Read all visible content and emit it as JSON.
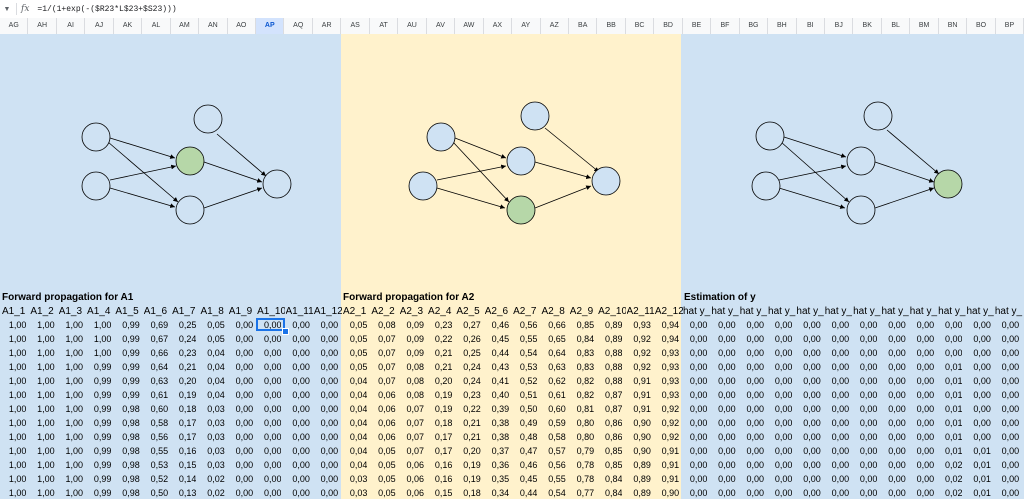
{
  "formula_bar": {
    "dropdown_icon": "chevron-down-icon",
    "fx_label": "fx",
    "formula": "=1/(1+exp(-($R23*L$23+$S23)))"
  },
  "columns": [
    "AG",
    "AH",
    "AI",
    "AJ",
    "AK",
    "AL",
    "AM",
    "AN",
    "AO",
    "AP",
    "AQ",
    "AR",
    "AS",
    "AT",
    "AU",
    "AV",
    "AW",
    "AX",
    "AY",
    "AZ",
    "BA",
    "BB",
    "BC",
    "BD",
    "BE",
    "BF",
    "BG",
    "BH",
    "BI",
    "BJ",
    "BK",
    "BL",
    "BM",
    "BN",
    "BO",
    "BP"
  ],
  "selected_column": "AP",
  "colors": {
    "panel_blue": "#cfe2f3",
    "panel_yellow": "#fff2cc",
    "node_blue": "#cfe2f3",
    "node_green": "#b6d7a8",
    "selection": "#1a73e8"
  },
  "sections": [
    {
      "title": "Forward propagation for A1",
      "headers": [
        "A1_1",
        "A1_2",
        "A1_3",
        "A1_4",
        "A1_5",
        "A1_6",
        "A1_7",
        "A1_8",
        "A1_9",
        "A1_10",
        "A1_11",
        "A1_12"
      ]
    },
    {
      "title": "Forward propagation for A2",
      "headers": [
        "A2_1",
        "A2_2",
        "A2_3",
        "A2_4",
        "A2_5",
        "A2_6",
        "A2_7",
        "A2_8",
        "A2_9",
        "A2_10",
        "A2_11",
        "A2_12"
      ]
    },
    {
      "title": "Estimation of y",
      "headers": [
        "hat y_",
        "hat y_",
        "hat y_",
        "hat y_",
        "hat y_",
        "hat y_",
        "hat y_",
        "hat y_",
        "hat y_",
        "hat y_",
        "hat y_",
        "hat y_"
      ]
    }
  ],
  "rows": [
    [
      [
        "1,00",
        "1,00",
        "1,00",
        "1,00",
        "0,99",
        "0,69",
        "0,25",
        "0,05",
        "0,00",
        "0,00",
        "0,00",
        "0,00"
      ],
      [
        "0,05",
        "0,08",
        "0,09",
        "0,23",
        "0,27",
        "0,46",
        "0,56",
        "0,66",
        "0,85",
        "0,89",
        "0,93",
        "0,94"
      ],
      [
        "0,00",
        "0,00",
        "0,00",
        "0,00",
        "0,00",
        "0,00",
        "0,00",
        "0,00",
        "0,00",
        "0,00",
        "0,00",
        "0,00"
      ]
    ],
    [
      [
        "1,00",
        "1,00",
        "1,00",
        "1,00",
        "0,99",
        "0,67",
        "0,24",
        "0,05",
        "0,00",
        "0,00",
        "0,00",
        "0,00"
      ],
      [
        "0,05",
        "0,07",
        "0,09",
        "0,22",
        "0,26",
        "0,45",
        "0,55",
        "0,65",
        "0,84",
        "0,89",
        "0,92",
        "0,94"
      ],
      [
        "0,00",
        "0,00",
        "0,00",
        "0,00",
        "0,00",
        "0,00",
        "0,00",
        "0,00",
        "0,00",
        "0,00",
        "0,00",
        "0,00"
      ]
    ],
    [
      [
        "1,00",
        "1,00",
        "1,00",
        "1,00",
        "0,99",
        "0,66",
        "0,23",
        "0,04",
        "0,00",
        "0,00",
        "0,00",
        "0,00"
      ],
      [
        "0,05",
        "0,07",
        "0,09",
        "0,21",
        "0,25",
        "0,44",
        "0,54",
        "0,64",
        "0,83",
        "0,88",
        "0,92",
        "0,93"
      ],
      [
        "0,00",
        "0,00",
        "0,00",
        "0,00",
        "0,00",
        "0,00",
        "0,00",
        "0,00",
        "0,00",
        "0,00",
        "0,00",
        "0,00"
      ]
    ],
    [
      [
        "1,00",
        "1,00",
        "1,00",
        "0,99",
        "0,99",
        "0,64",
        "0,21",
        "0,04",
        "0,00",
        "0,00",
        "0,00",
        "0,00"
      ],
      [
        "0,05",
        "0,07",
        "0,08",
        "0,21",
        "0,24",
        "0,43",
        "0,53",
        "0,63",
        "0,83",
        "0,88",
        "0,92",
        "0,93"
      ],
      [
        "0,00",
        "0,00",
        "0,00",
        "0,00",
        "0,00",
        "0,00",
        "0,00",
        "0,00",
        "0,00",
        "0,01",
        "0,00",
        "0,00"
      ]
    ],
    [
      [
        "1,00",
        "1,00",
        "1,00",
        "0,99",
        "0,99",
        "0,63",
        "0,20",
        "0,04",
        "0,00",
        "0,00",
        "0,00",
        "0,00"
      ],
      [
        "0,04",
        "0,07",
        "0,08",
        "0,20",
        "0,24",
        "0,41",
        "0,52",
        "0,62",
        "0,82",
        "0,88",
        "0,91",
        "0,93"
      ],
      [
        "0,00",
        "0,00",
        "0,00",
        "0,00",
        "0,00",
        "0,00",
        "0,00",
        "0,00",
        "0,00",
        "0,01",
        "0,00",
        "0,00"
      ]
    ],
    [
      [
        "1,00",
        "1,00",
        "1,00",
        "0,99",
        "0,99",
        "0,61",
        "0,19",
        "0,04",
        "0,00",
        "0,00",
        "0,00",
        "0,00"
      ],
      [
        "0,04",
        "0,06",
        "0,08",
        "0,19",
        "0,23",
        "0,40",
        "0,51",
        "0,61",
        "0,82",
        "0,87",
        "0,91",
        "0,93"
      ],
      [
        "0,00",
        "0,00",
        "0,00",
        "0,00",
        "0,00",
        "0,00",
        "0,00",
        "0,00",
        "0,00",
        "0,01",
        "0,00",
        "0,00"
      ]
    ],
    [
      [
        "1,00",
        "1,00",
        "1,00",
        "0,99",
        "0,98",
        "0,60",
        "0,18",
        "0,03",
        "0,00",
        "0,00",
        "0,00",
        "0,00"
      ],
      [
        "0,04",
        "0,06",
        "0,07",
        "0,19",
        "0,22",
        "0,39",
        "0,50",
        "0,60",
        "0,81",
        "0,87",
        "0,91",
        "0,92"
      ],
      [
        "0,00",
        "0,00",
        "0,00",
        "0,00",
        "0,00",
        "0,00",
        "0,00",
        "0,00",
        "0,00",
        "0,01",
        "0,00",
        "0,00"
      ]
    ],
    [
      [
        "1,00",
        "1,00",
        "1,00",
        "0,99",
        "0,98",
        "0,58",
        "0,17",
        "0,03",
        "0,00",
        "0,00",
        "0,00",
        "0,00"
      ],
      [
        "0,04",
        "0,06",
        "0,07",
        "0,18",
        "0,21",
        "0,38",
        "0,49",
        "0,59",
        "0,80",
        "0,86",
        "0,90",
        "0,92"
      ],
      [
        "0,00",
        "0,00",
        "0,00",
        "0,00",
        "0,00",
        "0,00",
        "0,00",
        "0,00",
        "0,00",
        "0,01",
        "0,00",
        "0,00"
      ]
    ],
    [
      [
        "1,00",
        "1,00",
        "1,00",
        "0,99",
        "0,98",
        "0,56",
        "0,17",
        "0,03",
        "0,00",
        "0,00",
        "0,00",
        "0,00"
      ],
      [
        "0,04",
        "0,06",
        "0,07",
        "0,17",
        "0,21",
        "0,38",
        "0,48",
        "0,58",
        "0,80",
        "0,86",
        "0,90",
        "0,92"
      ],
      [
        "0,00",
        "0,00",
        "0,00",
        "0,00",
        "0,00",
        "0,00",
        "0,00",
        "0,00",
        "0,00",
        "0,01",
        "0,00",
        "0,00"
      ]
    ],
    [
      [
        "1,00",
        "1,00",
        "1,00",
        "0,99",
        "0,98",
        "0,55",
        "0,16",
        "0,03",
        "0,00",
        "0,00",
        "0,00",
        "0,00"
      ],
      [
        "0,04",
        "0,05",
        "0,07",
        "0,17",
        "0,20",
        "0,37",
        "0,47",
        "0,57",
        "0,79",
        "0,85",
        "0,90",
        "0,91"
      ],
      [
        "0,00",
        "0,00",
        "0,00",
        "0,00",
        "0,00",
        "0,00",
        "0,00",
        "0,00",
        "0,00",
        "0,01",
        "0,01",
        "0,00"
      ]
    ],
    [
      [
        "1,00",
        "1,00",
        "1,00",
        "0,99",
        "0,98",
        "0,53",
        "0,15",
        "0,03",
        "0,00",
        "0,00",
        "0,00",
        "0,00"
      ],
      [
        "0,04",
        "0,05",
        "0,06",
        "0,16",
        "0,19",
        "0,36",
        "0,46",
        "0,56",
        "0,78",
        "0,85",
        "0,89",
        "0,91"
      ],
      [
        "0,00",
        "0,00",
        "0,00",
        "0,00",
        "0,00",
        "0,00",
        "0,00",
        "0,00",
        "0,00",
        "0,02",
        "0,01",
        "0,00"
      ]
    ],
    [
      [
        "1,00",
        "1,00",
        "1,00",
        "0,99",
        "0,98",
        "0,52",
        "0,14",
        "0,02",
        "0,00",
        "0,00",
        "0,00",
        "0,00"
      ],
      [
        "0,03",
        "0,05",
        "0,06",
        "0,16",
        "0,19",
        "0,35",
        "0,45",
        "0,55",
        "0,78",
        "0,84",
        "0,89",
        "0,91"
      ],
      [
        "0,00",
        "0,00",
        "0,00",
        "0,00",
        "0,00",
        "0,00",
        "0,00",
        "0,00",
        "0,00",
        "0,02",
        "0,01",
        "0,00"
      ]
    ],
    [
      [
        "1,00",
        "1,00",
        "1,00",
        "0,99",
        "0,98",
        "0,50",
        "0,13",
        "0,02",
        "0,00",
        "0,00",
        "0,00",
        "0,00"
      ],
      [
        "0,03",
        "0,05",
        "0,06",
        "0,15",
        "0,18",
        "0,34",
        "0,44",
        "0,54",
        "0,77",
        "0,84",
        "0,89",
        "0,90"
      ],
      [
        "0,00",
        "0,00",
        "0,00",
        "0,00",
        "0,00",
        "0,00",
        "0,00",
        "0,00",
        "0,00",
        "0,02",
        "0,01",
        "0,00"
      ]
    ]
  ]
}
